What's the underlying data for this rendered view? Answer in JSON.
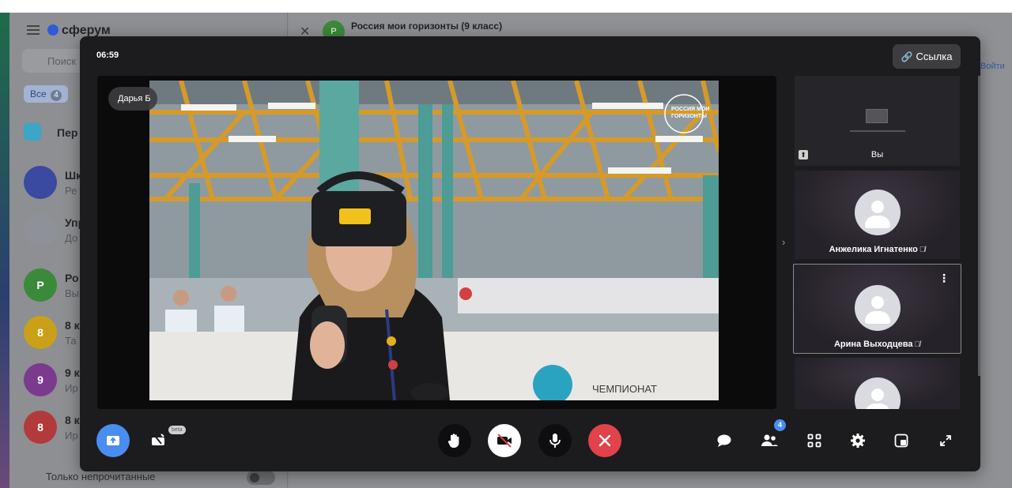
{
  "background": {
    "brand": "сферум",
    "search_placeholder": "Поиск",
    "filter_chip": {
      "label": "Все",
      "count": "4"
    },
    "chats": [
      {
        "initial": "",
        "name": "Шк",
        "sub": "Ре",
        "color": "#3a4aa0"
      },
      {
        "initial": "",
        "name": "Упр",
        "sub": "До",
        "color": "#8e9198"
      },
      {
        "initial": "Р",
        "name": "Ро",
        "sub": "Вы",
        "color": "#3b8a3a"
      },
      {
        "initial": "8",
        "name": "8 к",
        "sub": "Та",
        "color": "#c9a018"
      },
      {
        "initial": "9",
        "name": "9 к",
        "sub": "Ир",
        "color": "#7a3a8e"
      },
      {
        "initial": "8",
        "name": "8 к",
        "sub": "Ир",
        "color": "#b23a3a"
      }
    ],
    "section_label": "Пер",
    "unread_toggle_label": "Только непрочитанные",
    "chat_header": {
      "avatar_initial": "Р",
      "title": "Россия мои горизонты (9 класс)",
      "subtitle": ""
    },
    "chat_action": "Войти"
  },
  "call": {
    "timer": "06:59",
    "link_button": "Ссылка",
    "speaker_name": "Дарья Б",
    "video_logo_text": "РОССИЯ МОИ ГОРИЗОНТЫ",
    "video_sign_text": "ЧЕМПИОНАТ",
    "self_label": "Вы",
    "participants": [
      {
        "name": "Анжелика Игнатенко",
        "muted": true
      },
      {
        "name": "Арина Выходцева",
        "muted": true
      },
      {
        "name": "",
        "muted": false
      }
    ],
    "beta_label": "beta",
    "participants_count": "4",
    "icons": {
      "share_screen": "share-screen-icon",
      "effects": "effects-icon",
      "raise_hand": "hand-icon",
      "camera_off": "camera-off-icon",
      "mic": "mic-icon",
      "end_call": "end-call-icon",
      "chat": "chat-icon",
      "participants": "participants-icon",
      "grid": "grid-icon",
      "settings": "gear-icon",
      "layout": "layout-icon",
      "fullscreen": "fullscreen-icon"
    },
    "colors": {
      "accent": "#4a8df0",
      "danger": "#e2424a"
    }
  }
}
